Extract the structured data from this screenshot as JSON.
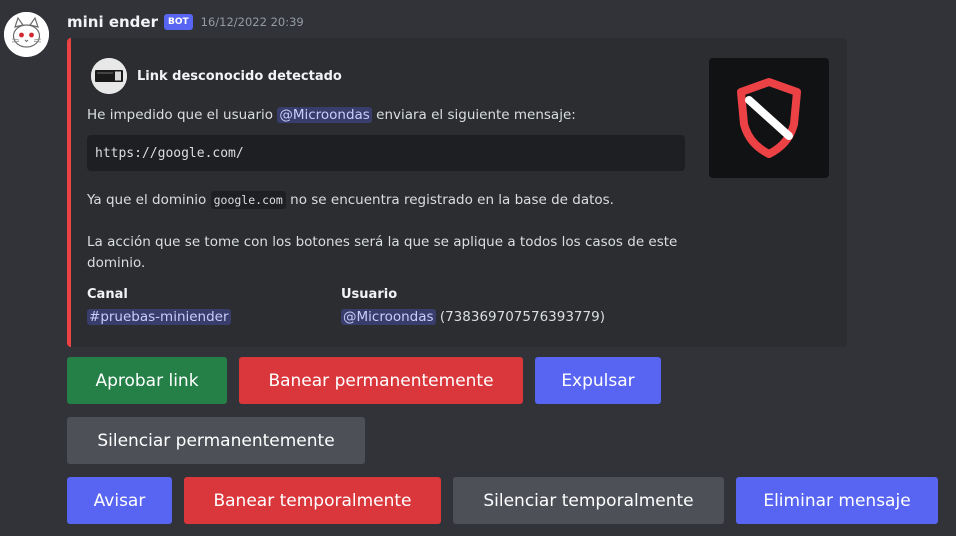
{
  "message": {
    "author": "mini ender",
    "bot_tag": "BOT",
    "timestamp": "16/12/2022 20:39"
  },
  "embed": {
    "accent_color": "#ed4245",
    "author_name": "Link desconocido detectado",
    "thumbnail_icon": "shield-slash-icon",
    "line1_before": "He impedido que el usuario ",
    "line1_mention": "@Microondas",
    "line1_after": " enviara el siguiente mensaje:",
    "code_block": "https://google.com/",
    "line2_before": "Ya que el dominio ",
    "line2_code": "google.com",
    "line2_after": " no se encuentra registrado en la base de datos.",
    "line3a": "La acción que se tome con los botones será la que se aplique a todos los casos de este",
    "line3b": "dominio.",
    "fields": {
      "canal_name": "Canal",
      "canal_value": "pruebas-miniender",
      "usuario_name": "Usuario",
      "usuario_mention": "@Microondas",
      "usuario_id": "(738369707576393779)"
    }
  },
  "buttons": {
    "row1": {
      "approve": "Aprobar link",
      "ban_perm": "Banear permanentemente",
      "kick": "Expulsar"
    },
    "row2": {
      "mute_perm": "Silenciar permanentemente"
    },
    "row3": {
      "warn": "Avisar",
      "ban_temp": "Banear temporalmente",
      "mute_temp": "Silenciar temporalmente",
      "delete": "Eliminar mensaje"
    }
  },
  "colors": {
    "background": "#313338",
    "embed_bg": "#2b2d31",
    "success": "#248046",
    "danger": "#da373c",
    "primary": "#5865f2",
    "secondary": "#4e5058"
  }
}
